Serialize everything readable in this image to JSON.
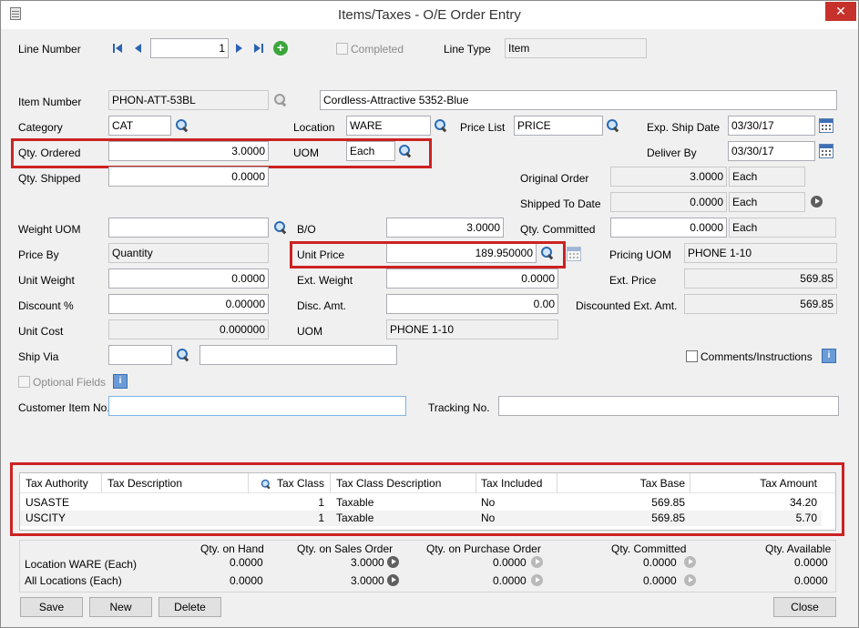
{
  "window": {
    "title": "Items/Taxes - O/E Order Entry",
    "close_glyph": "✕"
  },
  "header": {
    "line_number_label": "Line Number",
    "line_number": "1",
    "completed_label": "Completed",
    "line_type_label": "Line Type",
    "line_type": "Item",
    "item_number_label": "Item Number",
    "item_number": "PHON-ATT-53BL",
    "item_description": "Cordless-Attractive 5352-Blue"
  },
  "fields": {
    "category_label": "Category",
    "category": "CAT",
    "location_label": "Location",
    "location": "WARE",
    "price_list_label": "Price List",
    "price_list": "PRICE",
    "exp_ship_date_label": "Exp. Ship Date",
    "exp_ship_date": "03/30/17",
    "qty_ordered_label": "Qty. Ordered",
    "qty_ordered": "3.0000",
    "uom_label": "UOM",
    "uom": "Each",
    "deliver_by_label": "Deliver By",
    "deliver_by": "03/30/17",
    "qty_shipped_label": "Qty. Shipped",
    "qty_shipped": "0.0000",
    "original_order_label": "Original Order",
    "original_order": "3.0000",
    "original_order_uom": "Each",
    "shipped_to_date_label": "Shipped To Date",
    "shipped_to_date": "0.0000",
    "shipped_to_date_uom": "Each",
    "weight_uom_label": "Weight UOM",
    "weight_uom": "",
    "bo_label": "B/O",
    "bo": "3.0000",
    "qty_committed_label": "Qty. Committed",
    "qty_committed": "0.0000",
    "qty_committed_uom": "Each",
    "price_by_label": "Price By",
    "price_by": "Quantity",
    "unit_price_label": "Unit Price",
    "unit_price": "189.950000",
    "pricing_uom_label": "Pricing UOM",
    "pricing_uom": "PHONE 1-10",
    "unit_weight_label": "Unit Weight",
    "unit_weight": "0.0000",
    "ext_weight_label": "Ext. Weight",
    "ext_weight": "0.0000",
    "ext_price_label": "Ext. Price",
    "ext_price": "569.85",
    "discount_pct_label": "Discount %",
    "discount_pct": "0.00000",
    "disc_amt_label": "Disc. Amt.",
    "disc_amt": "0.00",
    "disc_ext_amt_label": "Discounted Ext. Amt.",
    "disc_ext_amt": "569.85",
    "unit_cost_label": "Unit Cost",
    "unit_cost": "0.000000",
    "uom2_label": "UOM",
    "uom2": "PHONE 1-10",
    "ship_via_label": "Ship Via",
    "ship_via": "",
    "ship_via_desc": "",
    "comments_label": "Comments/Instructions",
    "optional_fields_label": "Optional Fields",
    "customer_item_no_label": "Customer Item No.",
    "customer_item_no": "",
    "tracking_no_label": "Tracking No.",
    "tracking_no": ""
  },
  "tax_table": {
    "columns": [
      "Tax Authority",
      "Tax Description",
      "Tax Class",
      "Tax Class Description",
      "Tax Included",
      "Tax Base",
      "Tax Amount"
    ],
    "rows": [
      {
        "authority": "USASTE",
        "description": "",
        "class": "1",
        "class_desc": "Taxable",
        "included": "No",
        "base": "569.85",
        "amount": "34.20"
      },
      {
        "authority": "USCITY",
        "description": "",
        "class": "1",
        "class_desc": "Taxable",
        "included": "No",
        "base": "569.85",
        "amount": "5.70"
      }
    ]
  },
  "quantities": {
    "headers": {
      "on_hand": "Qty. on Hand",
      "on_sales_order": "Qty. on Sales Order",
      "on_purchase_order": "Qty. on Purchase Order",
      "committed": "Qty. Committed",
      "available": "Qty. Available"
    },
    "rows": [
      {
        "label": "Location  WARE (Each)",
        "on_hand": "0.0000",
        "on_sales_order": "3.0000",
        "on_purchase_order": "0.0000",
        "committed": "0.0000",
        "available": "0.0000"
      },
      {
        "label": "All Locations (Each)",
        "on_hand": "0.0000",
        "on_sales_order": "3.0000",
        "on_purchase_order": "0.0000",
        "committed": "0.0000",
        "available": "0.0000"
      }
    ]
  },
  "buttons": {
    "save": "Save",
    "new": "New",
    "delete": "Delete",
    "close": "Close"
  },
  "colors": {
    "highlight": "#cc2222",
    "accent": "#2c63b3",
    "titlebar_close": "#c7312b"
  }
}
